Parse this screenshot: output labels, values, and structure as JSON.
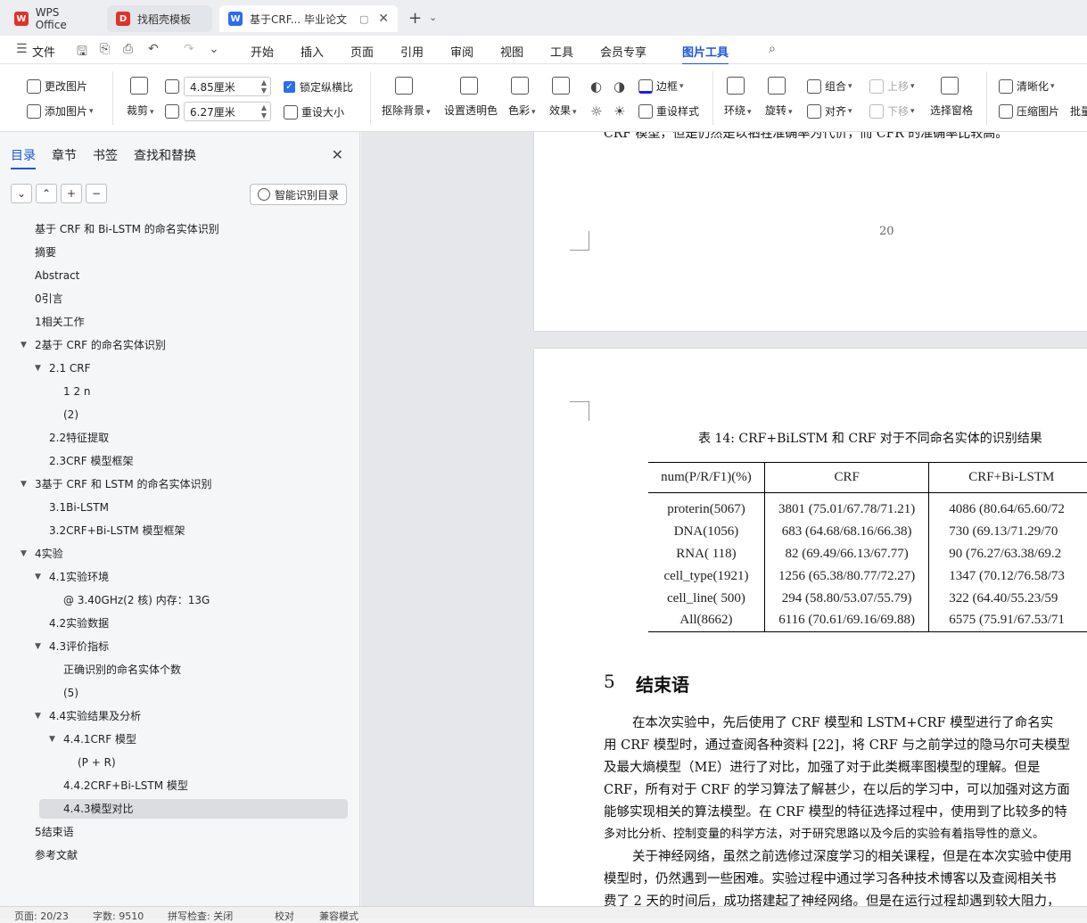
{
  "tabs": [
    {
      "label": "WPS Office"
    },
    {
      "label": "找稻壳模板"
    },
    {
      "label": "基于CRF... 毕业论文"
    }
  ],
  "menu": [
    "文件",
    "开始",
    "插入",
    "页面",
    "引用",
    "审阅",
    "视图",
    "工具",
    "会员专享",
    "图片工具"
  ],
  "ribbon": {
    "change_image": "更改图片",
    "add_image": "添加图片",
    "crop": "裁剪",
    "width": "4.85厘米",
    "height": "6.27厘米",
    "lock_ratio": "锁定纵横比",
    "reset_size": "重设大小",
    "remove_bg": "抠除背景",
    "set_transparent": "设置透明色",
    "color": "色彩",
    "effect": "效果",
    "border": "边框",
    "reset_style": "重设样式",
    "wrap": "环绕",
    "rotate": "旋转",
    "group": "组合",
    "align": "对齐",
    "move_up": "上移",
    "move_down": "下移",
    "selection_pane": "选择窗格",
    "sharpen": "清晰化",
    "compress": "压缩图片",
    "batch": "批量"
  },
  "sidebar": {
    "tabs": [
      "目录",
      "章节",
      "书签",
      "查找和替换"
    ],
    "smart_toc": "智能识别目录",
    "toc": [
      {
        "label": "基于 CRF 和 Bi-LSTM 的命名实体识别",
        "level": 0
      },
      {
        "label": "摘要",
        "level": 0
      },
      {
        "label": "Abstract",
        "level": 0
      },
      {
        "label": "0引言",
        "level": 0
      },
      {
        "label": "1相关工作",
        "level": 0
      },
      {
        "label": "2基于 CRF 的命名实体识别",
        "level": 0,
        "expanded": true
      },
      {
        "label": "2.1 CRF",
        "level": 1,
        "expanded": true
      },
      {
        "label": "1 2 n",
        "level": 2
      },
      {
        "label": "(2)",
        "level": 2
      },
      {
        "label": "2.2特征提取",
        "level": 1
      },
      {
        "label": "2.3CRF 模型框架",
        "level": 1
      },
      {
        "label": "3基于 CRF 和 LSTM 的命名实体识别",
        "level": 0,
        "expanded": true
      },
      {
        "label": "3.1Bi-LSTM",
        "level": 1
      },
      {
        "label": "3.2CRF+Bi-LSTM 模型框架",
        "level": 1
      },
      {
        "label": "4实验",
        "level": 0,
        "expanded": true
      },
      {
        "label": "4.1实验环境",
        "level": 1,
        "expanded": true
      },
      {
        "label": "@ 3.40GHz(2 核) 内存：13G",
        "level": 2
      },
      {
        "label": "4.2实验数据",
        "level": 1
      },
      {
        "label": "4.3评价指标",
        "level": 1,
        "expanded": true
      },
      {
        "label": "正确识别的命名实体个数",
        "level": 2
      },
      {
        "label": "(5)",
        "level": 2
      },
      {
        "label": "4.4实验结果及分析",
        "level": 1,
        "expanded": true
      },
      {
        "label": "4.4.1CRF 模型",
        "level": 2,
        "expanded": true
      },
      {
        "label": "(P + R)",
        "level": 3
      },
      {
        "label": "4.4.2CRF+Bi-LSTM 模型",
        "level": 2
      },
      {
        "label": "4.4.3模型对比",
        "level": 2,
        "selected": true
      },
      {
        "label": "5结束语",
        "level": 0
      },
      {
        "label": "参考文献",
        "level": 0
      }
    ]
  },
  "doc": {
    "top_line": "CRF 模型，但是仍然是以牺牲准确率为代价，而 CFR 的准确率比较高。",
    "page_number": "20",
    "table_caption": "表 14: CRF+BiLSTM 和 CRF 对于不同命名实体的识别结果",
    "table_headers": [
      "num(P/R/F1)(%)",
      "CRF",
      "CRF+Bi-LSTM"
    ],
    "table_rows": [
      [
        "proterin(5067)",
        "3801 (75.01/67.78/71.21)",
        "4086 (80.64/65.60/72"
      ],
      [
        "DNA(1056)",
        "683 (64.68/68.16/66.38)",
        "730 (69.13/71.29/70"
      ],
      [
        "RNA( 118)",
        "82 (69.49/66.13/67.77)",
        "90 (76.27/63.38/69.2"
      ],
      [
        "cell_type(1921)",
        "1256 (65.38/80.77/72.27)",
        "1347 (70.12/76.58/73"
      ],
      [
        "cell_line( 500)",
        "294 (58.80/53.07/55.79)",
        "322 (64.40/55.23/59"
      ],
      [
        "All(8662)",
        "6116 (70.61/69.16/69.88)",
        "6575 (75.91/67.53/71"
      ]
    ],
    "section_number": "5",
    "section_title": "结束语",
    "paragraph_lines": [
      "在本次实验中，先后使用了 CRF 模型和 LSTM+CRF 模型进行了命名实",
      "用 CRF 模型时，通过查阅各种资料 [22]，将 CRF 与之前学过的隐马尔可夫模型",
      "及最大熵模型（ME）进行了对比，加强了对于此类概率图模型的理解。但是",
      "CRF，所有对于 CRF 的学习算法了解甚少，在以后的学习中，可以加强对这方面",
      "能够实现相关的算法模型。在 CRF 模型的特征选择过程中，使用到了比较多的特",
      "多对比分析、控制变量的科学方法，对于研究思路以及今后的实验有着指导性的意义。",
      "关于神经网络，虽然之前选修过深度学习的相关课程，但是在本次实验中使用",
      "模型时，仍然遇到一些困难。实验过程中通过学习各种技术博客以及查阅相关书",
      "费了 2 天的时间后，成功搭建起了神经网络。但是在运行过程却遇到较大阻力，"
    ]
  },
  "status": {
    "page": "页面: 20/23",
    "words": "字数: 9510",
    "spell": "拼写检查: 关闭",
    "proof": "校对",
    "compat": "兼容模式"
  }
}
